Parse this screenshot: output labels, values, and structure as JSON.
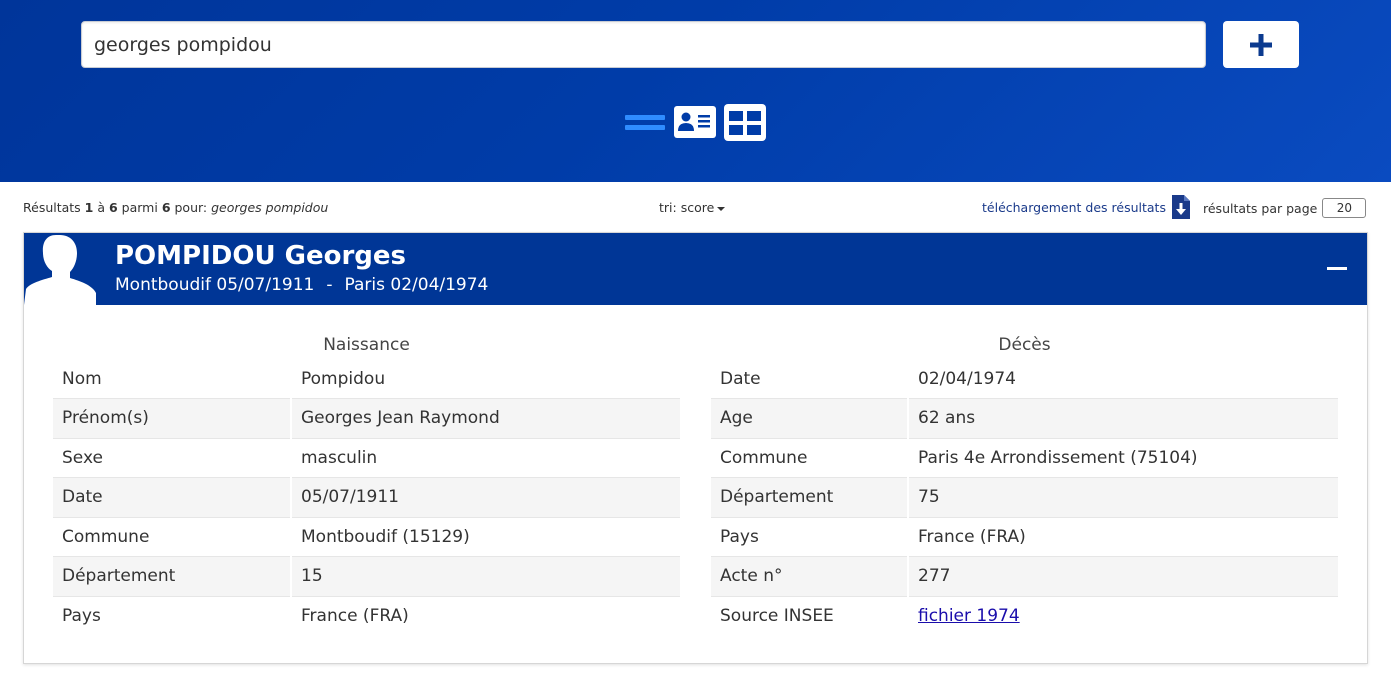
{
  "search": {
    "value": "georges pompidou"
  },
  "colors": {
    "header_bg": "#003696",
    "band_bg": "#003ca8",
    "accent": "#2f8cff"
  },
  "results": {
    "prefix": "Résultats ",
    "from": "1",
    "mid1": " à ",
    "to": "6",
    "mid2": " parmi ",
    "total": "6",
    "mid3": " pour: ",
    "query": "georges pompidou",
    "sort_label": "tri: score",
    "download_label": "téléchargement des résultats",
    "per_page_label": "résultats par page",
    "per_page_value": "20"
  },
  "person": {
    "name": "POMPIDOU Georges",
    "birth_place": "Montboudif 05/07/1911",
    "separator": "-",
    "death_place": "Paris 02/04/1974"
  },
  "birth": {
    "title": "Naissance",
    "rows": [
      {
        "label": "Nom",
        "value": "Pompidou"
      },
      {
        "label": "Prénom(s)",
        "value": "Georges Jean Raymond"
      },
      {
        "label": "Sexe",
        "value": "masculin"
      },
      {
        "label": "Date",
        "value": "05/07/1911"
      },
      {
        "label": "Commune",
        "value": "Montboudif (15129)"
      },
      {
        "label": "Département",
        "value": "15"
      },
      {
        "label": "Pays",
        "value": "France (FRA)"
      }
    ]
  },
  "death": {
    "title": "Décès",
    "rows": [
      {
        "label": "Date",
        "value": "02/04/1974"
      },
      {
        "label": "Age",
        "value": "62 ans"
      },
      {
        "label": "Commune",
        "value": "Paris 4e Arrondissement (75104)"
      },
      {
        "label": "Département",
        "value": "75"
      },
      {
        "label": "Pays",
        "value": "France (FRA)"
      },
      {
        "label": "Acte n°",
        "value": "277"
      },
      {
        "label": "Source INSEE",
        "value": "fichier 1974"
      }
    ]
  }
}
